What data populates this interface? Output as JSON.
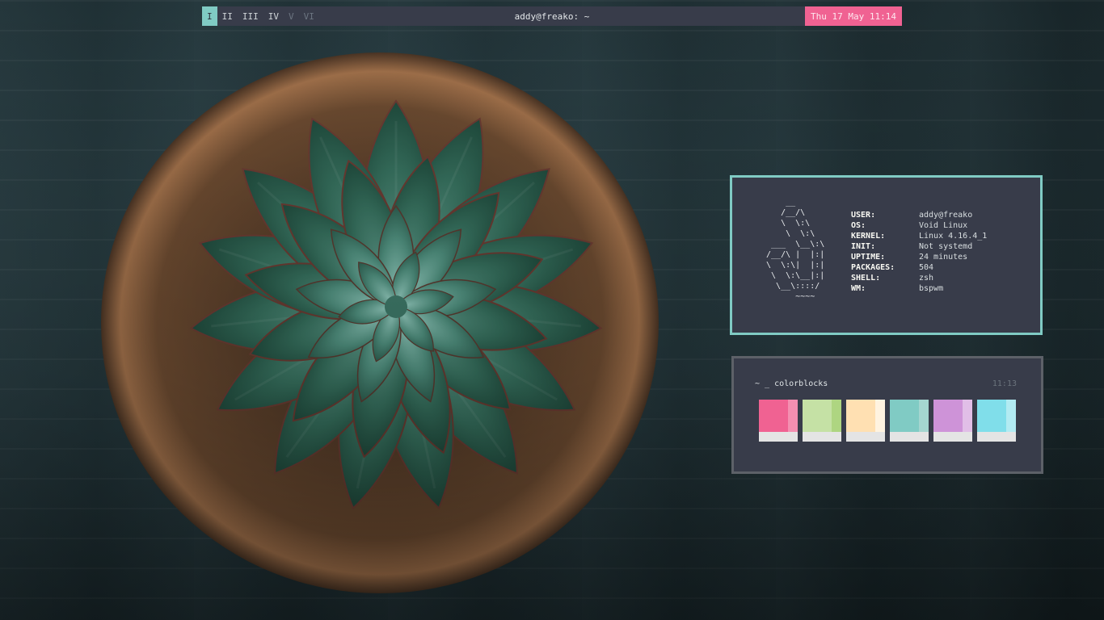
{
  "topbar": {
    "workspaces": [
      {
        "label": "I",
        "state": "active"
      },
      {
        "label": "II",
        "state": "occupied"
      },
      {
        "label": "III",
        "state": "occupied"
      },
      {
        "label": "IV",
        "state": "occupied"
      },
      {
        "label": "V",
        "state": "empty"
      },
      {
        "label": "VI",
        "state": "empty"
      }
    ],
    "title": "addy@freako: ~",
    "clock": "Thu 17 May 11:14"
  },
  "fetch": {
    "ascii_art": "     __\n    /__/\\\n    \\  \\:\\\n     \\  \\:\\\n  ___  \\__\\:\\\n /__/\\ |  |:|\n \\  \\:\\|  |:|\n  \\  \\:\\__|:|\n   \\__\\::::/\n       ~~~~",
    "rows": [
      {
        "key": "USER:",
        "value": "addy@freako"
      },
      {
        "key": "OS:",
        "value": "Void Linux"
      },
      {
        "key": "KERNEL:",
        "value": "Linux 4.16.4_1"
      },
      {
        "key": "INIT:",
        "value": "Not systemd"
      },
      {
        "key": "UPTIME:",
        "value": "24 minutes"
      },
      {
        "key": "PACKAGES:",
        "value": "504"
      },
      {
        "key": "SHELL:",
        "value": "zsh"
      },
      {
        "key": "WM:",
        "value": "bspwm"
      }
    ]
  },
  "colorblocks": {
    "title": "~ _ colorblocks",
    "time": "11:13",
    "swatches": [
      {
        "main": "#f06292",
        "side": "#f48fb1"
      },
      {
        "main": "#c5e1a5",
        "side": "#aed581"
      },
      {
        "main": "#ffe0b2",
        "side": "#fff3e0"
      },
      {
        "main": "#80cbc4",
        "side": "#a5d6d0"
      },
      {
        "main": "#ce93d8",
        "side": "#e1bee7"
      },
      {
        "main": "#80deea",
        "side": "#b2ebf2"
      }
    ]
  },
  "colors": {
    "bar_bg": "#383c4a",
    "accent_teal": "#80cbc4",
    "accent_pink": "#f06292"
  }
}
